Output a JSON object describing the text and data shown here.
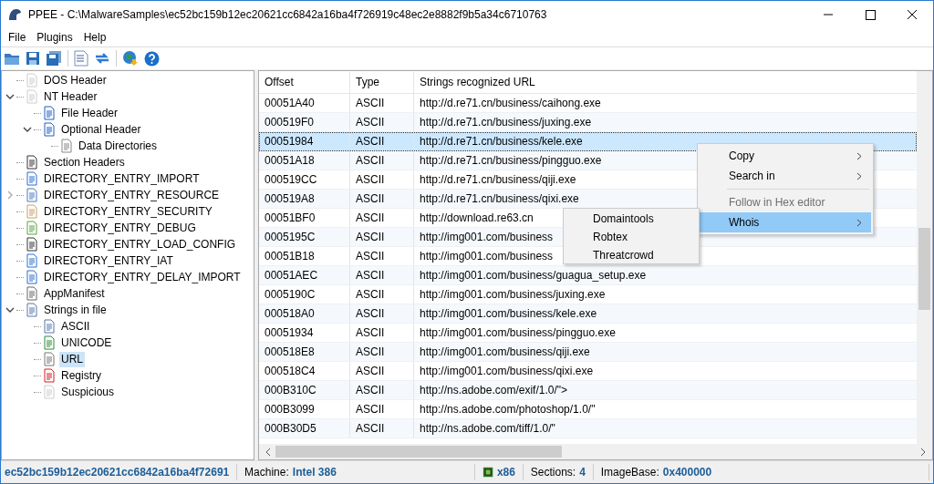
{
  "window": {
    "title": "PPEE - C:\\MalwareSamples\\ec52bc159b12ec20621cc6842a16ba4f726919c48ec2e8882f9b5a34c6710763"
  },
  "menu": [
    "File",
    "Plugins",
    "Help"
  ],
  "tree": [
    {
      "label": "DOS Header",
      "selected": false
    },
    {
      "label": "NT Header",
      "selected": false,
      "expanded": true,
      "children": [
        {
          "label": "File Header",
          "selected": false
        },
        {
          "label": "Optional Header",
          "selected": false,
          "expanded": true,
          "children": [
            {
              "label": "Data Directories",
              "selected": false
            }
          ]
        }
      ]
    },
    {
      "label": "Section Headers",
      "selected": false
    },
    {
      "label": "DIRECTORY_ENTRY_IMPORT",
      "selected": false
    },
    {
      "label": "DIRECTORY_ENTRY_RESOURCE",
      "selected": false,
      "expanded": false
    },
    {
      "label": "DIRECTORY_ENTRY_SECURITY",
      "selected": false
    },
    {
      "label": "DIRECTORY_ENTRY_DEBUG",
      "selected": false
    },
    {
      "label": "DIRECTORY_ENTRY_LOAD_CONFIG",
      "selected": false
    },
    {
      "label": "DIRECTORY_ENTRY_IAT",
      "selected": false
    },
    {
      "label": "DIRECTORY_ENTRY_DELAY_IMPORT",
      "selected": false
    },
    {
      "label": "AppManifest",
      "selected": false
    },
    {
      "label": "Strings in file",
      "selected": false,
      "expanded": true,
      "children": [
        {
          "label": "ASCII",
          "selected": false
        },
        {
          "label": "UNICODE",
          "selected": false
        },
        {
          "label": "URL",
          "selected": true
        },
        {
          "label": "Registry",
          "selected": false
        },
        {
          "label": "Suspicious",
          "selected": false
        }
      ]
    }
  ],
  "table": {
    "columns": [
      "Offset",
      "Type",
      "Strings recognized URL"
    ],
    "rows": [
      {
        "cells": [
          "00051A40",
          "ASCII",
          "http://d.re71.cn/business/caihong.exe"
        ],
        "selected": false
      },
      {
        "cells": [
          "000519F0",
          "ASCII",
          "http://d.re71.cn/business/juxing.exe"
        ],
        "selected": false
      },
      {
        "cells": [
          "00051984",
          "ASCII",
          "http://d.re71.cn/business/kele.exe"
        ],
        "selected": true
      },
      {
        "cells": [
          "00051A18",
          "ASCII",
          "http://d.re71.cn/business/pingguo.exe"
        ],
        "selected": false
      },
      {
        "cells": [
          "000519CC",
          "ASCII",
          "http://d.re71.cn/business/qiji.exe"
        ],
        "selected": false
      },
      {
        "cells": [
          "000519A8",
          "ASCII",
          "http://d.re71.cn/business/qixi.exe"
        ],
        "selected": false
      },
      {
        "cells": [
          "00051BF0",
          "ASCII",
          "http://download.re63.cn"
        ],
        "selected": false
      },
      {
        "cells": [
          "0005195C",
          "ASCII",
          "http://img001.com/business"
        ],
        "selected": false
      },
      {
        "cells": [
          "00051B18",
          "ASCII",
          "http://img001.com/business"
        ],
        "selected": false
      },
      {
        "cells": [
          "00051AEC",
          "ASCII",
          "http://img001.com/business/guagua_setup.exe"
        ],
        "selected": false
      },
      {
        "cells": [
          "0005190C",
          "ASCII",
          "http://img001.com/business/juxing.exe"
        ],
        "selected": false
      },
      {
        "cells": [
          "000518A0",
          "ASCII",
          "http://img001.com/business/kele.exe"
        ],
        "selected": false
      },
      {
        "cells": [
          "00051934",
          "ASCII",
          "http://img001.com/business/pingguo.exe"
        ],
        "selected": false
      },
      {
        "cells": [
          "000518E8",
          "ASCII",
          "http://img001.com/business/qiji.exe"
        ],
        "selected": false
      },
      {
        "cells": [
          "000518C4",
          "ASCII",
          "http://img001.com/business/qixi.exe"
        ],
        "selected": false
      },
      {
        "cells": [
          "000B310C",
          "ASCII",
          "http://ns.adobe.com/exif/1.0/\">"
        ],
        "selected": false
      },
      {
        "cells": [
          "000B3099",
          "ASCII",
          "http://ns.adobe.com/photoshop/1.0/\""
        ],
        "selected": false
      },
      {
        "cells": [
          "000B30D5",
          "ASCII",
          "http://ns.adobe.com/tiff/1.0/\""
        ],
        "selected": false
      }
    ]
  },
  "context_menu": [
    {
      "label": "Copy",
      "submenu": true,
      "disabled": false,
      "selected": false
    },
    {
      "label": "Search in",
      "submenu": true,
      "disabled": false,
      "selected": false
    },
    {
      "kind": "separator"
    },
    {
      "label": "Follow in Hex editor",
      "submenu": false,
      "disabled": true,
      "selected": false
    },
    {
      "label": "Whois",
      "submenu": true,
      "disabled": false,
      "selected": true
    }
  ],
  "submenu": [
    "Domaintools",
    "Robtex",
    "Threatcrowd"
  ],
  "status_bar": {
    "file": "ec52bc159b12ec20621cc6842a16ba4f72691",
    "machine_label": "Machine:",
    "machine": "Intel 386",
    "arch": "x86",
    "sections_label": "Sections:",
    "sections": "4",
    "imagebase_label": "ImageBase:",
    "imagebase": "0x400000"
  }
}
